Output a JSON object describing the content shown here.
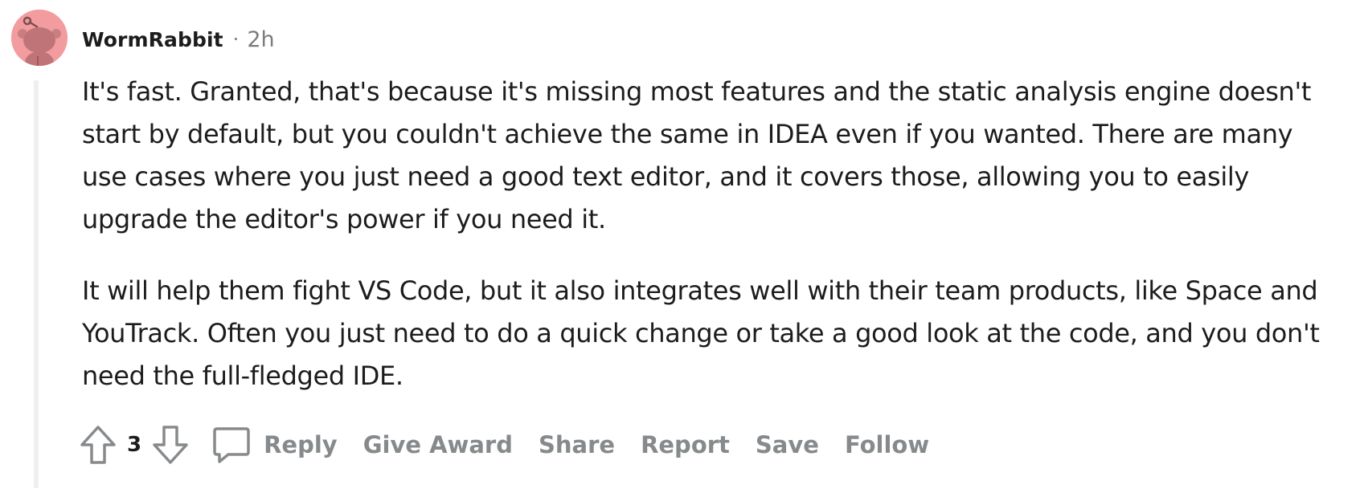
{
  "comment": {
    "author": "WormRabbit",
    "separator": "·",
    "time_ago": "2h",
    "avatar_icon": "reddit-snoo-avatar-icon",
    "avatar_color": "#f29c9f",
    "paragraphs": [
      "It's fast. Granted, that's because it's missing most features and the static analysis engine doesn't start by default, but you couldn't achieve the same in IDEA even if you wanted. There are many use cases where you just need a good text editor, and it covers those, allowing you to easily upgrade the editor's power if you need it.",
      "It will help them fight VS Code, but it also integrates well with their team products, like Space and YouTrack. Often you just need to do a quick change or take a good look at the code, and you don't need the full-fledged IDE."
    ]
  },
  "actions": {
    "upvote_icon": "arrow-up-icon",
    "vote_count": "3",
    "downvote_icon": "arrow-down-icon",
    "reply_icon": "speech-bubble-icon",
    "reply_label": "Reply",
    "give_award_label": "Give Award",
    "share_label": "Share",
    "report_label": "Report",
    "save_label": "Save",
    "follow_label": "Follow",
    "muted_color": "#878a8c"
  }
}
